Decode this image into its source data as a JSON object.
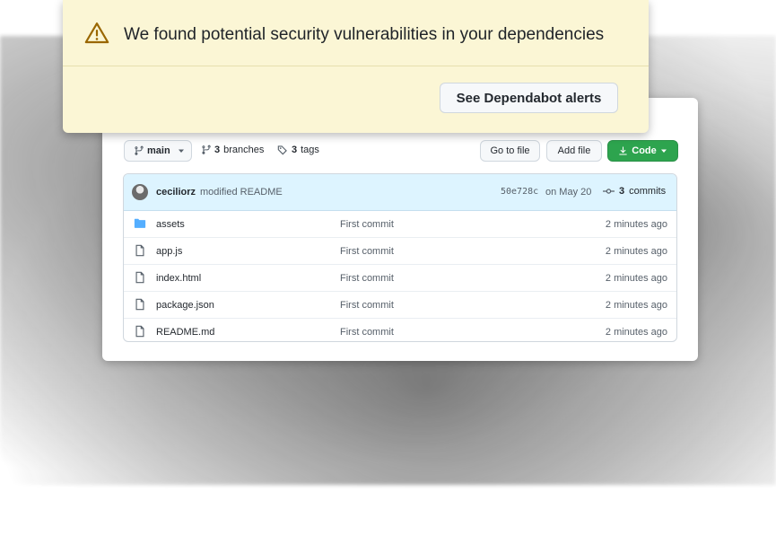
{
  "alert": {
    "message": "We found potential security vulnerabilities in your dependencies",
    "button_label": "See Dependabot alerts",
    "icon": "warning-triangle-icon",
    "background_color": "#fbf6d5"
  },
  "toolbar": {
    "branch_label": "main",
    "branches_count": "3",
    "branches_label": "branches",
    "tags_count": "3",
    "tags_label": "tags",
    "goto_file_label": "Go to file",
    "add_file_label": "Add file",
    "code_label": "Code",
    "code_button_color": "#2da44e"
  },
  "latest_commit": {
    "author": "ceciliorz",
    "message": "modified README",
    "hash": "50e728c",
    "date": "on May 20",
    "commits_count": "3",
    "commits_label": "commits"
  },
  "files": [
    {
      "name": "assets",
      "type": "folder",
      "commit": "First commit",
      "age": "2 minutes ago"
    },
    {
      "name": "app.js",
      "type": "file",
      "commit": "First commit",
      "age": "2 minutes ago"
    },
    {
      "name": "index.html",
      "type": "file",
      "commit": "First commit",
      "age": "2 minutes ago"
    },
    {
      "name": "package.json",
      "type": "file",
      "commit": "First commit",
      "age": "2 minutes ago"
    },
    {
      "name": "README.md",
      "type": "file",
      "commit": "First commit",
      "age": "2 minutes ago"
    }
  ]
}
